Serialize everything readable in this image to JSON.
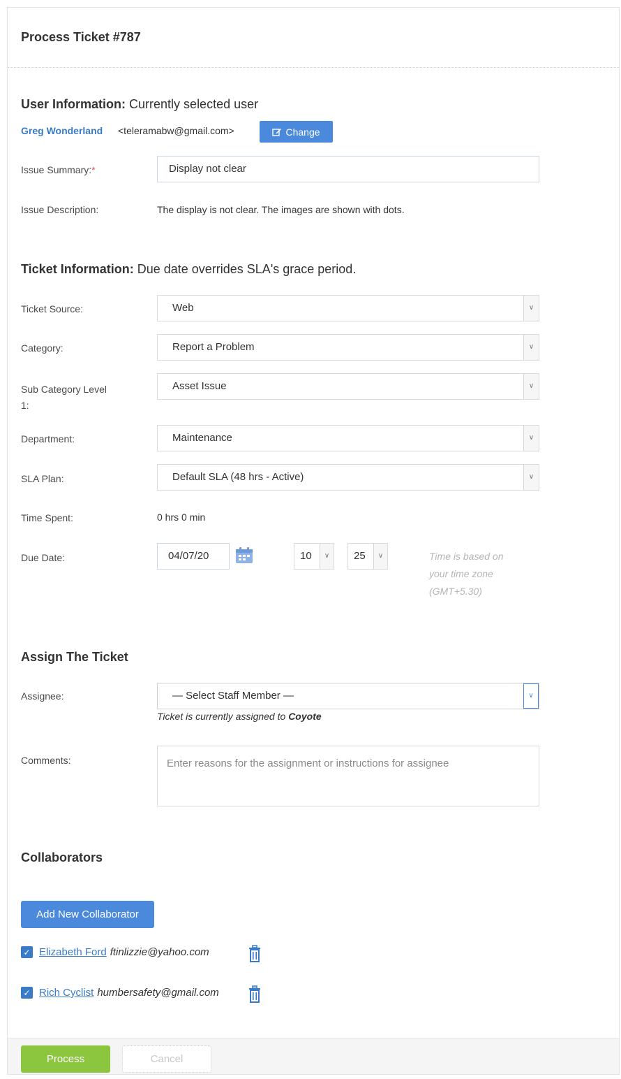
{
  "page": {
    "title": "Process Ticket #787"
  },
  "user_info": {
    "heading": "User Information:",
    "heading_sub": "Currently selected user",
    "user_name": "Greg Wonderland",
    "user_email": "<teleramabw@gmail.com>",
    "change_label": "Change",
    "change_icon": "edit-icon"
  },
  "issue": {
    "summary_label": "Issue Summary:",
    "required_mark": "*",
    "summary_value": "Display not clear",
    "description_label": "Issue Description:",
    "description_value": "The display is not clear. The images are shown with dots."
  },
  "ticket_info": {
    "heading": "Ticket Information:",
    "heading_sub": "Due date overrides SLA's grace period.",
    "source_label": "Ticket Source:",
    "source_value": "Web",
    "category_label": "Category:",
    "category_value": "Report a Problem",
    "subcategory_label_line1": "Sub Category Level",
    "subcategory_label_line2": "1:",
    "subcategory_value": "Asset Issue",
    "department_label": "Department:",
    "department_value": "Maintenance",
    "sla_label": "SLA Plan:",
    "sla_value": "Default SLA (48 hrs - Active)",
    "time_spent_label": "Time Spent:",
    "time_spent_value": "0 hrs 0 min",
    "due_date_label": "Due Date:",
    "due_date_value": "04/07/20",
    "hour_value": "10",
    "minute_value": "25",
    "timezone_note_line1": "Time is based on",
    "timezone_note_line2": "your time zone",
    "timezone_note_line3": "(GMT+5.30)"
  },
  "assign": {
    "heading": "Assign The Ticket",
    "assignee_label": "Assignee:",
    "assignee_value": "— Select Staff Member —",
    "assigned_hint": "Ticket is currently assigned to ",
    "assigned_to": "Coyote",
    "comments_label": "Comments:",
    "comments_placeholder": "Enter reasons for the assignment or instructions for assignee"
  },
  "collaborators": {
    "heading": "Collaborators",
    "add_label": "Add New Collaborator",
    "items": [
      {
        "name": "Elizabeth Ford",
        "email": "ftinlizzie@yahoo.com",
        "checked": true
      },
      {
        "name": "Rich Cyclist",
        "email": "humbersafety@gmail.com",
        "checked": true
      }
    ]
  },
  "footer": {
    "process_label": "Process",
    "cancel_label": "Cancel"
  },
  "colors": {
    "accent_blue": "#4a89dc",
    "link_blue": "#3a7bc8",
    "process_green": "#8cc63f",
    "required_red": "#d9534f"
  }
}
